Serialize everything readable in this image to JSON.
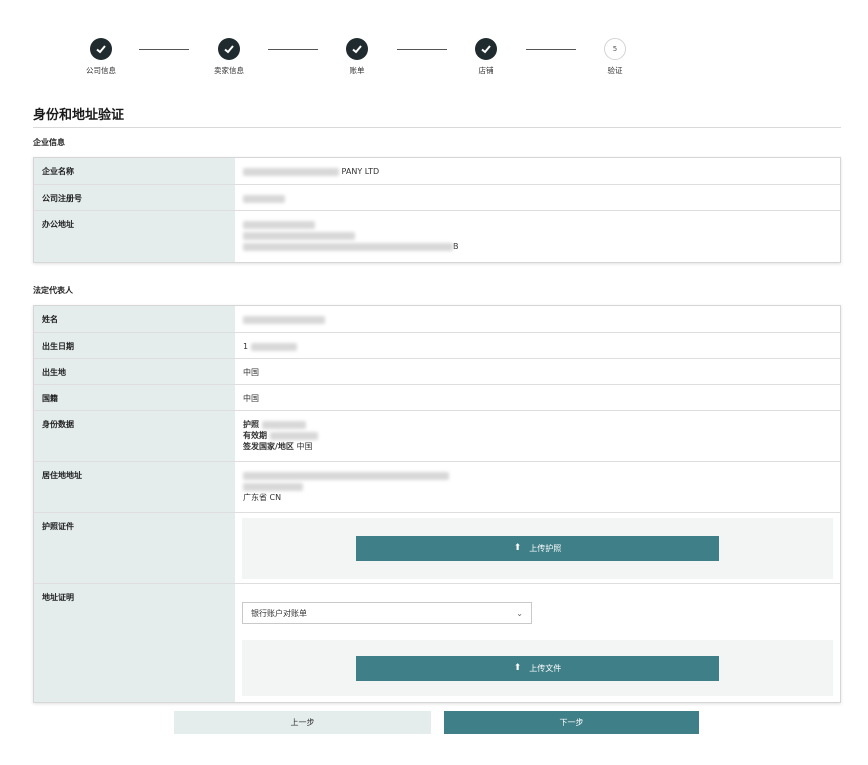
{
  "stepper": {
    "steps": [
      {
        "label": "公司信息",
        "status": "done"
      },
      {
        "label": "卖家信息",
        "status": "done"
      },
      {
        "label": "账单",
        "status": "done"
      },
      {
        "label": "店铺",
        "status": "done"
      },
      {
        "label": "验证",
        "status": "current",
        "number": "5"
      }
    ]
  },
  "page_title": "身份和地址验证",
  "company": {
    "section_title": "企业信息",
    "rows": [
      {
        "key": "企业名称",
        "value": "PANY LTD"
      },
      {
        "key": "公司注册号",
        "value": ""
      },
      {
        "key": "办公地址",
        "value_line3_suffix": "B"
      }
    ]
  },
  "legal_rep": {
    "section_title": "法定代表人",
    "rows": [
      {
        "key": "姓名",
        "value": ""
      },
      {
        "key": "出生日期",
        "value": "1"
      },
      {
        "key": "出生地",
        "value": "中国"
      },
      {
        "key": "国籍",
        "value": "中国"
      },
      {
        "key": "身份数据",
        "passport_label": "护照",
        "expiry_label": "有效期",
        "issuing_label": "签发国家/地区",
        "issuing_value": "中国"
      },
      {
        "key": "居住地地址",
        "value_line2": "广东省 CN"
      },
      {
        "key": "护照证件",
        "upload_label": "上传护照"
      },
      {
        "key": "地址证明",
        "select_value": "银行账户对账单",
        "upload_label": "上传文件"
      }
    ]
  },
  "footer": {
    "prev_label": "上一步",
    "next_label": "下一步"
  },
  "colors": {
    "accent": "#3f7f88",
    "key_bg": "#e4ecec",
    "step_done": "#1f2b2e"
  }
}
